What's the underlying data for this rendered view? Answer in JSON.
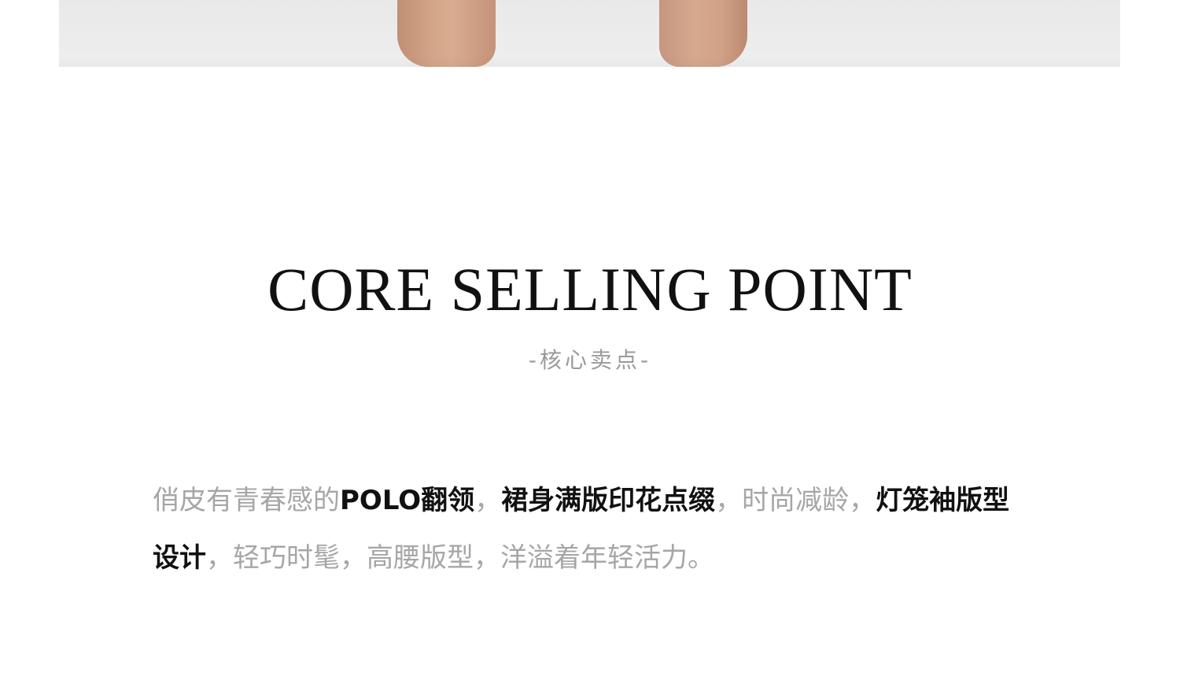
{
  "header": {
    "title": "CORE SELLING POINT",
    "subtitle": "-核心卖点-"
  },
  "description": {
    "segments": [
      {
        "text": "俏皮有青春感的",
        "emphasis": false
      },
      {
        "text": "POLO翻领",
        "emphasis": true
      },
      {
        "text": "，",
        "emphasis": false
      },
      {
        "text": "裙身满版印花点缀",
        "emphasis": true
      },
      {
        "text": "，时尚减龄，",
        "emphasis": false
      },
      {
        "text": "灯笼袖版型设计",
        "emphasis": true
      },
      {
        "text": "，轻巧时髦，高腰版型，洋溢着年轻活力。",
        "emphasis": false
      }
    ]
  },
  "colors": {
    "background": "#ffffff",
    "title": "#111111",
    "subtitle": "#9a9a9a",
    "body_text": "#a6a6a6",
    "emphasis_text": "#111111"
  }
}
